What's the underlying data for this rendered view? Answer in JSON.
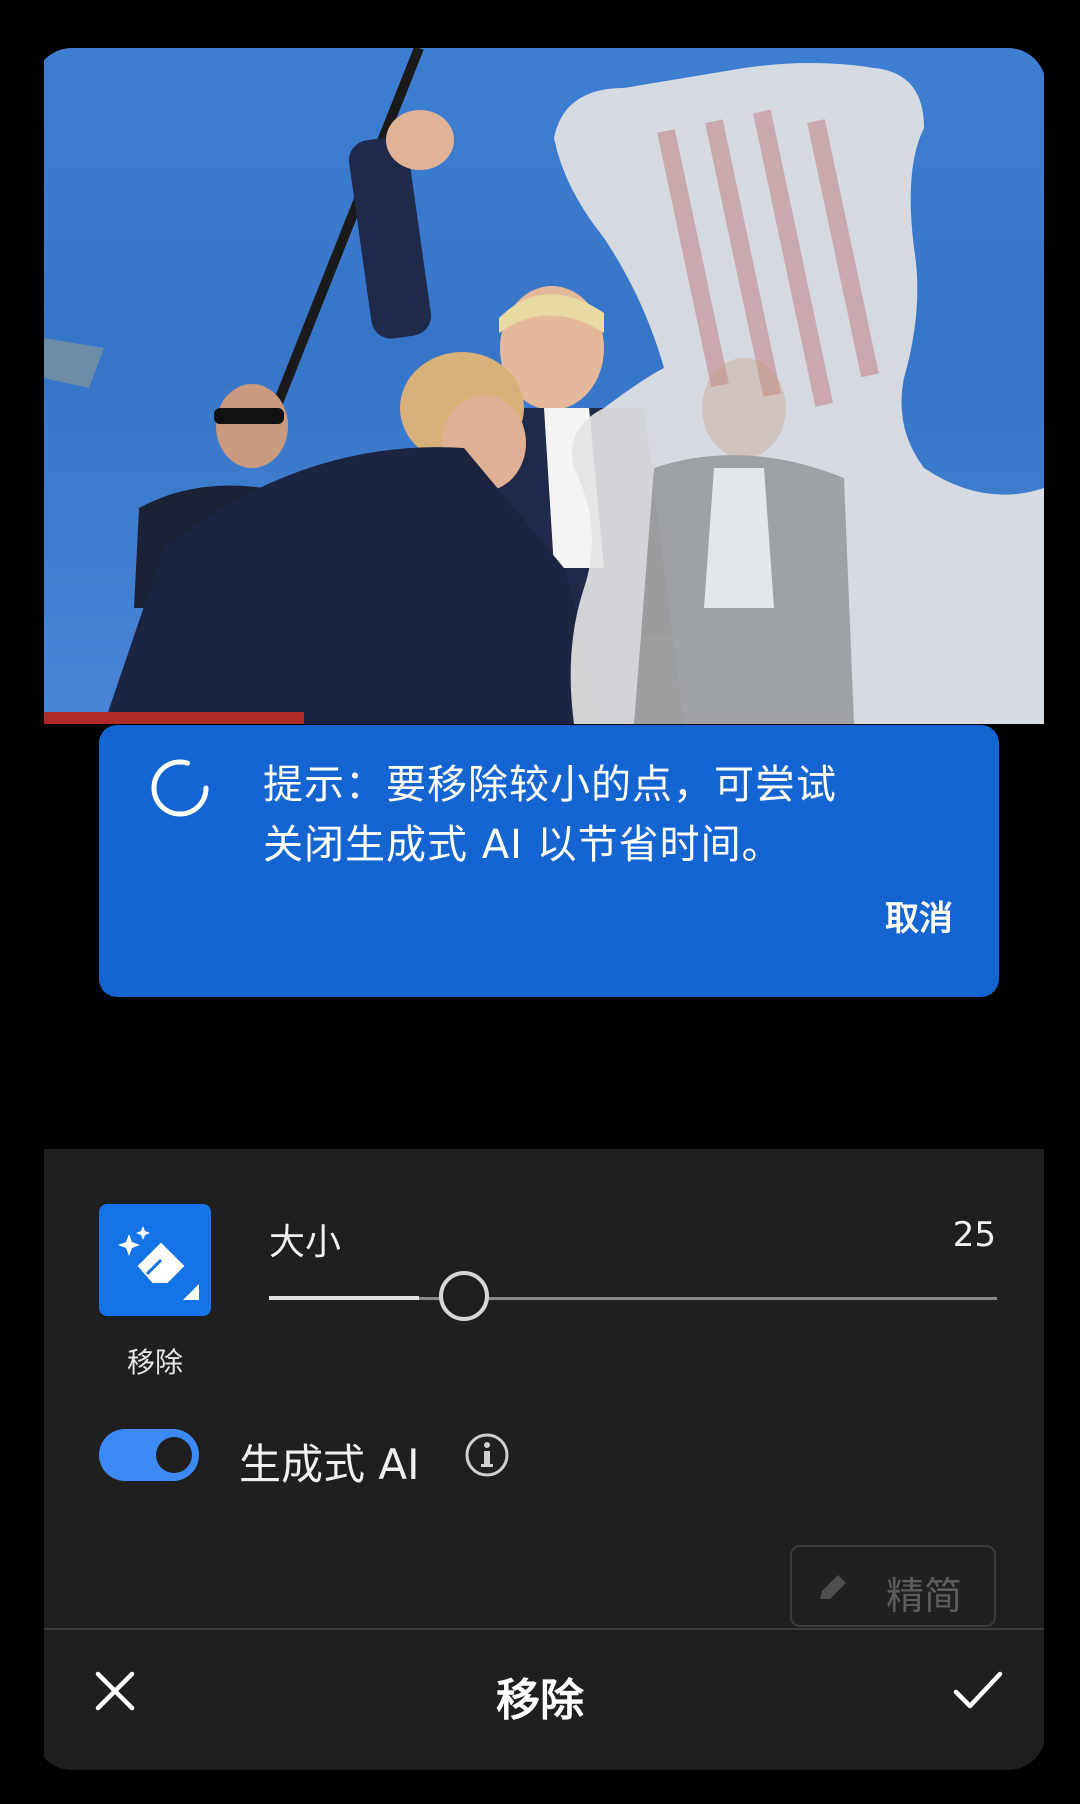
{
  "photo": {
    "description": "Edited photo with selected removal region"
  },
  "tip": {
    "line1": "提示：要移除较小的点，可尝试",
    "line2": "关闭生成式 AI 以节省时间。",
    "cancel_label": "取消"
  },
  "tool": {
    "label": "移除",
    "icon": "eraser-sparkle-icon"
  },
  "size": {
    "label": "大小",
    "value": "25",
    "fraction": 0.25
  },
  "generative_ai": {
    "label": "生成式 AI",
    "enabled": true
  },
  "refine": {
    "label": "精简",
    "enabled": false
  },
  "footer": {
    "title": "移除"
  },
  "colors": {
    "accent": "#1473e6",
    "tip_bg": "#1465d1",
    "panel_bg": "#1f1f1f"
  }
}
